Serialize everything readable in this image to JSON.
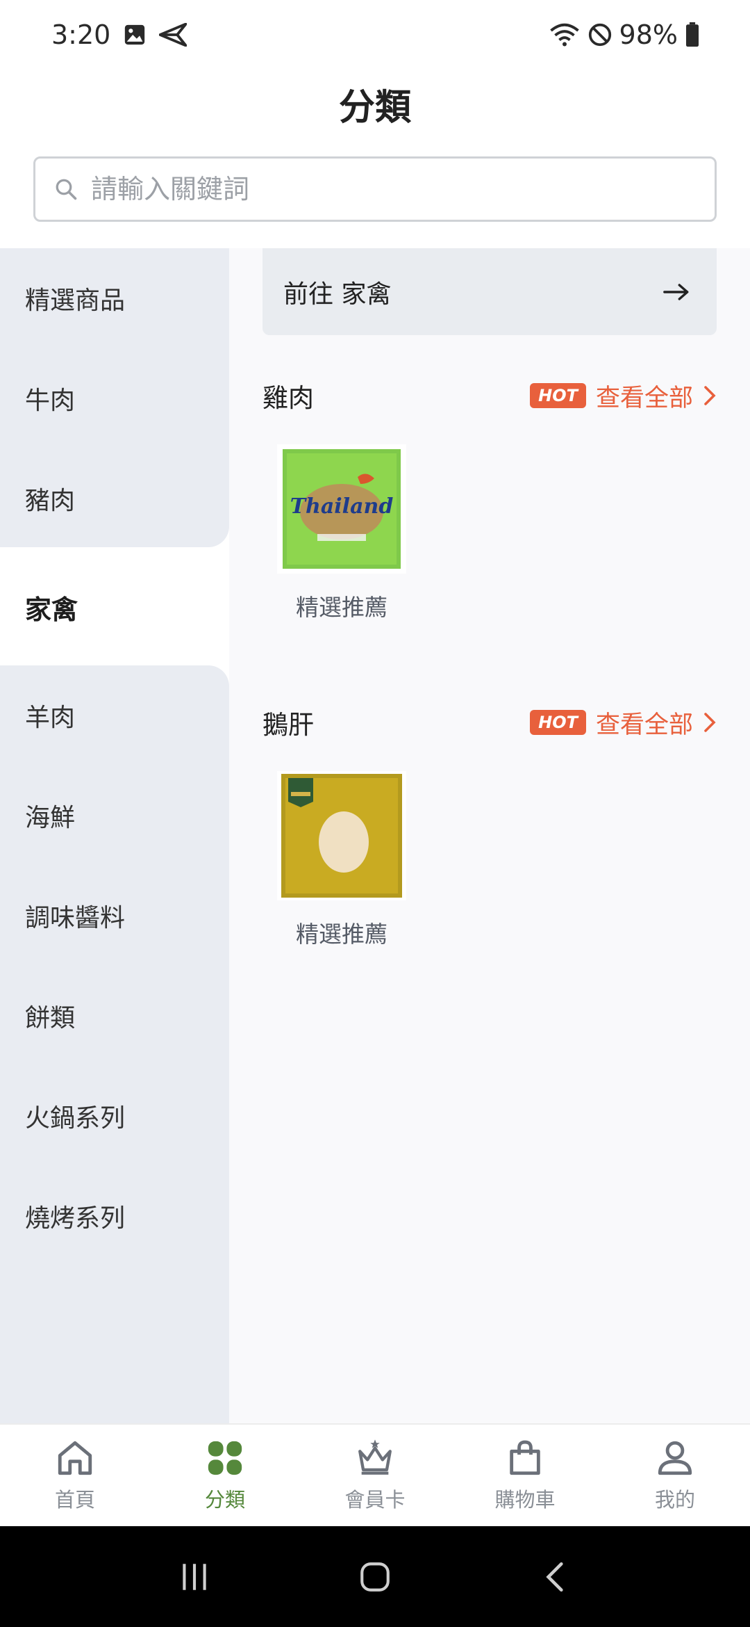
{
  "status_bar": {
    "time": "3:20",
    "battery": "98%"
  },
  "header": {
    "title": "分類"
  },
  "search": {
    "placeholder": "請輸入關鍵詞"
  },
  "sidebar": {
    "items": [
      {
        "label": "精選商品"
      },
      {
        "label": "牛肉"
      },
      {
        "label": "豬肉"
      },
      {
        "label": "家禽",
        "active": true
      },
      {
        "label": "羊肉"
      },
      {
        "label": "海鮮"
      },
      {
        "label": "調味醬料"
      },
      {
        "label": "餅類"
      },
      {
        "label": "火鍋系列"
      },
      {
        "label": "燒烤系列"
      }
    ]
  },
  "main": {
    "goto_label": "前往 家禽",
    "sections": [
      {
        "title": "雞肉",
        "badge": "HOT",
        "see_all": "查看全部",
        "products": [
          {
            "name": "精選推薦",
            "package_text": "Thailand"
          }
        ]
      },
      {
        "title": "鵝肝",
        "badge": "HOT",
        "see_all": "查看全部",
        "products": [
          {
            "name": "精選推薦"
          }
        ]
      }
    ]
  },
  "bottom_nav": {
    "items": [
      {
        "label": "首頁",
        "icon": "home-icon"
      },
      {
        "label": "分類",
        "icon": "grid-icon",
        "active": true
      },
      {
        "label": "會員卡",
        "icon": "crown-icon"
      },
      {
        "label": "購物車",
        "icon": "shopping-bag-icon"
      },
      {
        "label": "我的",
        "icon": "user-icon"
      }
    ]
  },
  "colors": {
    "accent": "#e8603c",
    "active_nav": "#55883b",
    "sidebar_bg": "#e9ecf2"
  }
}
